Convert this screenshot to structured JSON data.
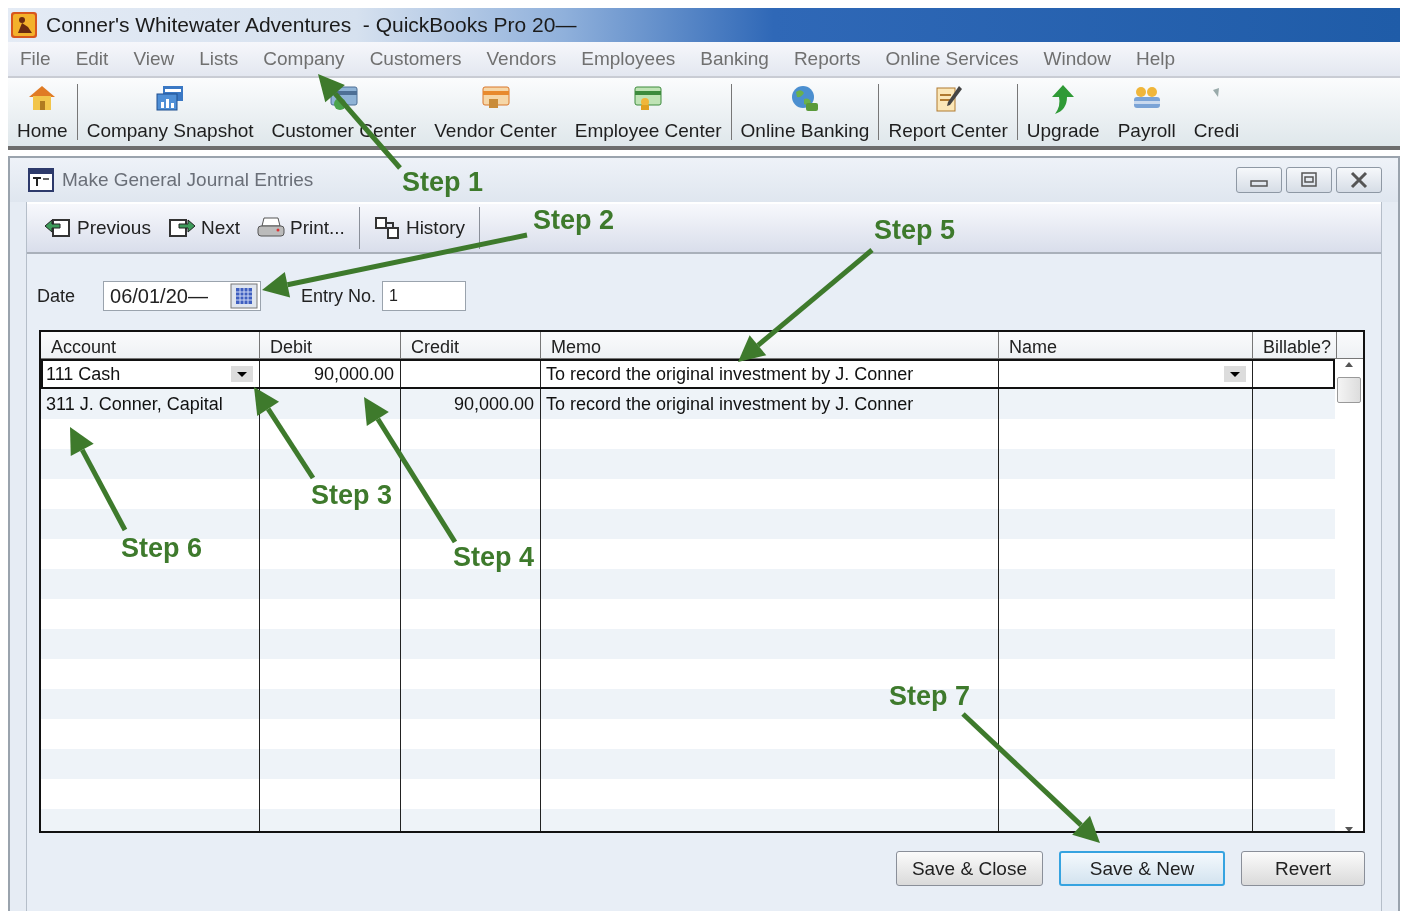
{
  "window": {
    "title": "Conner's Whitewater Adventures  - QuickBooks Pro 20—"
  },
  "menu": [
    "File",
    "Edit",
    "View",
    "Lists",
    "Company",
    "Customers",
    "Vendors",
    "Employees",
    "Banking",
    "Reports",
    "Online Services",
    "Window",
    "Help"
  ],
  "toolbar": [
    {
      "label": "Home",
      "kind": "home",
      "separator_after": true
    },
    {
      "label": "Company Snapshot",
      "kind": "snapshot",
      "separator_after": false
    },
    {
      "label": "Customer Center",
      "kind": "customer",
      "separator_after": false
    },
    {
      "label": "Vendor Center",
      "kind": "vendor",
      "separator_after": false
    },
    {
      "label": "Employee Center",
      "kind": "employee",
      "separator_after": true
    },
    {
      "label": "Online Banking",
      "kind": "globe",
      "separator_after": true
    },
    {
      "label": "Report Center",
      "kind": "report",
      "separator_after": true
    },
    {
      "label": "Upgrade",
      "kind": "upgrade",
      "separator_after": false
    },
    {
      "label": "Payroll",
      "kind": "payroll",
      "separator_after": false
    },
    {
      "label": "Credi",
      "kind": "partial",
      "separator_after": false
    }
  ],
  "form": {
    "title": "Make General Journal Entries",
    "actions": [
      {
        "label": "Previous",
        "kind": "previous",
        "separator_after": false
      },
      {
        "label": "Next",
        "kind": "next",
        "separator_after": false
      },
      {
        "label": "Print...",
        "kind": "print",
        "separator_after": true
      },
      {
        "label": "History",
        "kind": "history",
        "separator_after": true
      }
    ],
    "date_label": "Date",
    "date": "06/01/20—",
    "entry_label": "Entry No.",
    "entry_no": "1",
    "columns": [
      "Account",
      "Debit",
      "Credit",
      "Memo",
      "Name",
      "Billable?"
    ],
    "rows": [
      {
        "account": "111 Cash",
        "debit": "90,000.00",
        "memo": "To record the original investment by J. Conner",
        "selected": true
      },
      {
        "account": "311 J. Conner, Capital",
        "credit": "90,000.00",
        "memo": "To record the original investment by J. Conner",
        "selected": false
      }
    ],
    "buttons": [
      {
        "label": "Save & Close",
        "focused": false
      },
      {
        "label": "Save & New",
        "focused": true
      },
      {
        "label": "Revert",
        "focused": false
      }
    ]
  },
  "annotations": [
    "Step 1",
    "Step 2",
    "Step 3",
    "Step 4",
    "Step 5",
    "Step 6",
    "Step 7"
  ]
}
